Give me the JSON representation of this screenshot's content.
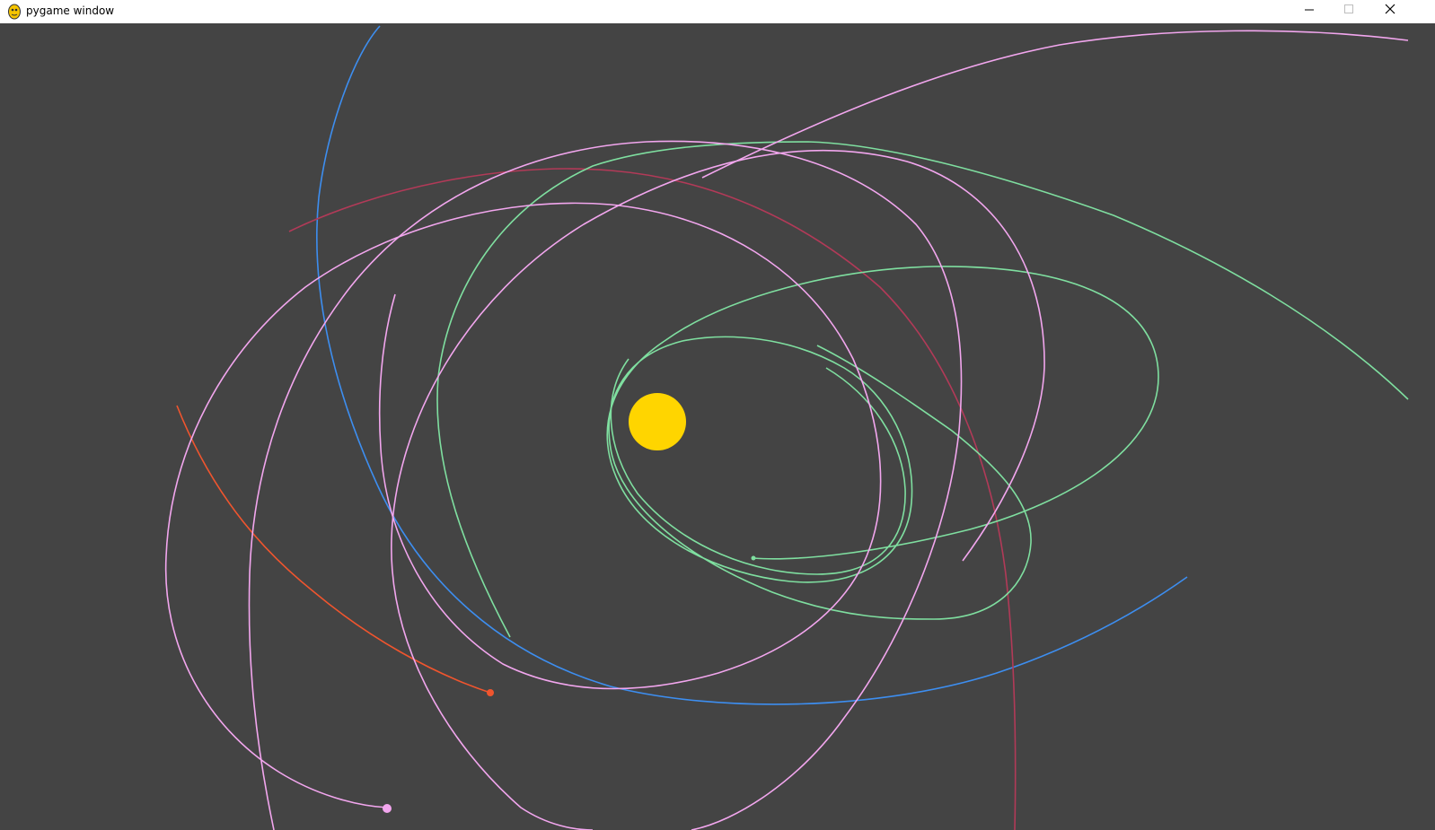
{
  "window": {
    "title": "pygame window",
    "icon": "pygame-snake-icon",
    "controls": [
      {
        "name": "minimize",
        "icon": "minimize-icon"
      },
      {
        "name": "maximize",
        "icon": "maximize-icon"
      },
      {
        "name": "close",
        "icon": "close-icon"
      }
    ]
  },
  "scene": {
    "background": "#444444",
    "sun": {
      "color": "#FFD500"
    },
    "trail_colors": {
      "blue": "#3D8EF0",
      "green": "#7FDFA0",
      "pink": "#F2A6EE",
      "crimson": "#B23A58",
      "orange": "#F0552E"
    },
    "bodies": [
      {
        "name": "orange-planet",
        "color": "#F0552E"
      },
      {
        "name": "pink-planet",
        "color": "#F2A6EE"
      },
      {
        "name": "green-planet",
        "color": "#7FDFA0"
      }
    ]
  }
}
